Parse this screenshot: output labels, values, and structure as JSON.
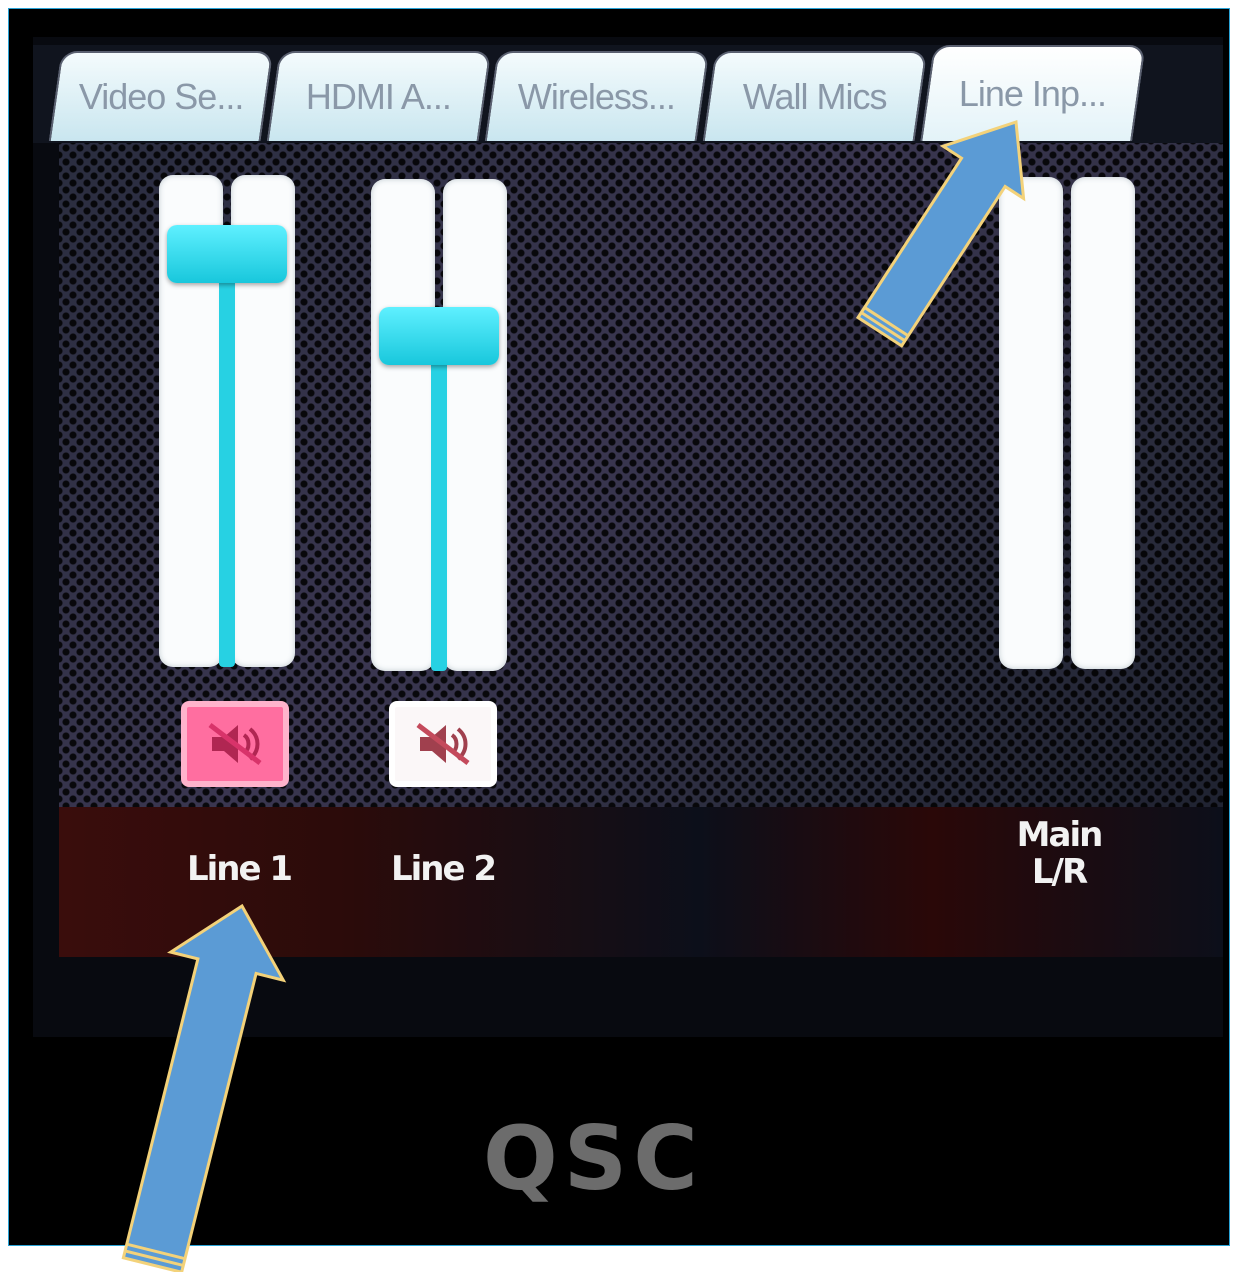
{
  "tabs": [
    {
      "label": "Video Se...",
      "active": false
    },
    {
      "label": "HDMI A...",
      "active": false
    },
    {
      "label": "Wireless...",
      "active": false
    },
    {
      "label": "Wall Mics",
      "active": false
    },
    {
      "label": "Line Inp...",
      "active": true
    }
  ],
  "channels": [
    {
      "label": "Line 1",
      "level": 0.84,
      "muted": true
    },
    {
      "label": "Line 2",
      "level": 0.68,
      "muted": false
    }
  ],
  "main": {
    "line1": "Main",
    "line2": "L/R"
  },
  "brand": "QSC",
  "colors": {
    "accent": "#27d1e3",
    "mute_on": "#ff6ea0",
    "annotation_arrow": "#5b9bd5",
    "annotation_outline": "#f3d27a"
  },
  "icons": {
    "mute": "speaker-muted-icon",
    "annotation": "arrow-icon"
  }
}
